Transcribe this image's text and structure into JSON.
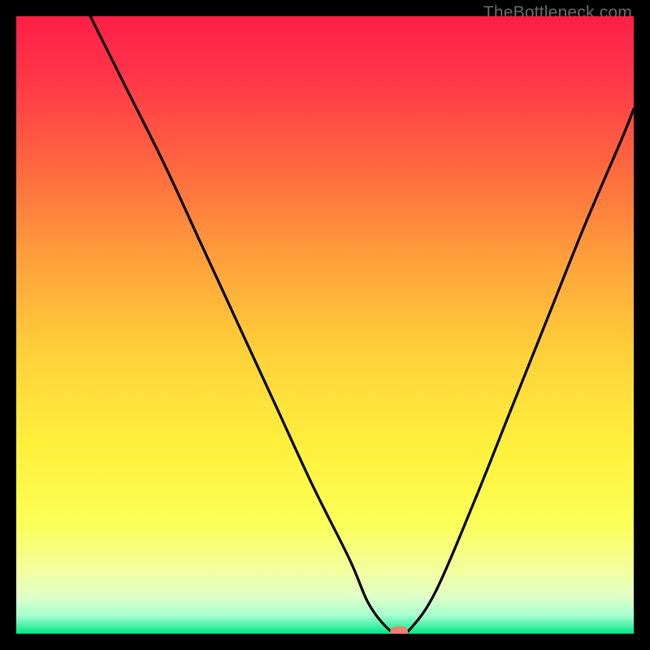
{
  "watermark": "TheBottleneck.com",
  "chart_data": {
    "type": "line",
    "title": "",
    "xlabel": "",
    "ylabel": "",
    "xlim": [
      0,
      100
    ],
    "ylim": [
      0,
      100
    ],
    "curve": [
      {
        "x": 12,
        "y": 100
      },
      {
        "x": 18,
        "y": 88
      },
      {
        "x": 24,
        "y": 76
      },
      {
        "x": 30,
        "y": 63
      },
      {
        "x": 36,
        "y": 50
      },
      {
        "x": 42,
        "y": 37
      },
      {
        "x": 48,
        "y": 24
      },
      {
        "x": 54,
        "y": 12
      },
      {
        "x": 57,
        "y": 5
      },
      {
        "x": 60,
        "y": 1
      },
      {
        "x": 62,
        "y": 0
      },
      {
        "x": 64,
        "y": 1
      },
      {
        "x": 68,
        "y": 7
      },
      {
        "x": 74,
        "y": 21
      },
      {
        "x": 80,
        "y": 36
      },
      {
        "x": 86,
        "y": 51
      },
      {
        "x": 92,
        "y": 66
      },
      {
        "x": 98,
        "y": 80
      },
      {
        "x": 100,
        "y": 85
      }
    ],
    "marker": {
      "x": 62,
      "y": 0
    },
    "gradient_stops": [
      {
        "offset": 0.0,
        "color": "#ff1f47"
      },
      {
        "offset": 0.1,
        "color": "#ff3648"
      },
      {
        "offset": 0.25,
        "color": "#ff6a3f"
      },
      {
        "offset": 0.4,
        "color": "#ffa23b"
      },
      {
        "offset": 0.55,
        "color": "#ffd23a"
      },
      {
        "offset": 0.7,
        "color": "#fff13c"
      },
      {
        "offset": 0.82,
        "color": "#fbff56"
      },
      {
        "offset": 0.9,
        "color": "#f3ffa0"
      },
      {
        "offset": 0.94,
        "color": "#e0ffc8"
      },
      {
        "offset": 0.97,
        "color": "#a7ffce"
      },
      {
        "offset": 1.0,
        "color": "#00e588"
      }
    ],
    "marker_color": "#ef8071"
  }
}
